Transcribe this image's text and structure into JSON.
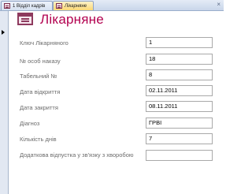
{
  "tabs": [
    {
      "label": "1 Відділ кадрів",
      "active": false
    },
    {
      "label": "Лікарняне",
      "active": true
    }
  ],
  "form": {
    "title": "Лікарняне",
    "icon": "form-icon",
    "accent_color": "#b2004f",
    "fields": [
      {
        "label": "Ключ Лікарняного",
        "value": "1"
      },
      {
        "label": "№ особ наказу",
        "value": "18"
      },
      {
        "label": "Табельний №",
        "value": "8"
      },
      {
        "label": "Дата відкриття",
        "value": "02.11.2011"
      },
      {
        "label": "Дата закриття",
        "value": "08.11.2011"
      },
      {
        "label": "Діагноз",
        "value": "ГРВІ"
      },
      {
        "label": "Кількість днів",
        "value": "7"
      },
      {
        "label": "Додаткова відпустка у зв'язку з хворобою",
        "value": ""
      }
    ]
  },
  "window": {
    "close_glyph": "×"
  }
}
